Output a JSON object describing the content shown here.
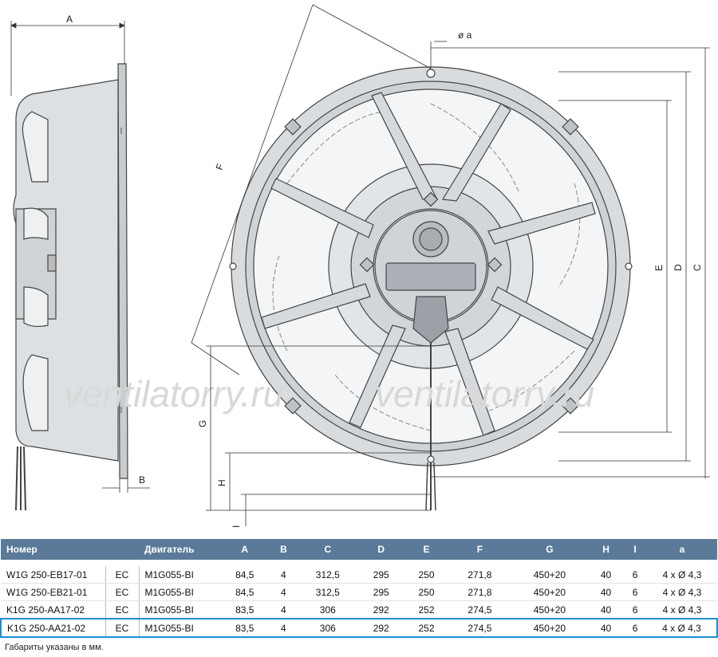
{
  "drawing": {
    "dim_labels": {
      "A": "A",
      "B": "B",
      "C": "C",
      "D": "D",
      "E": "E",
      "F": "F",
      "G": "G",
      "H": "H",
      "I": "I",
      "a": "ø a"
    },
    "watermark": "ventilatorry.ru"
  },
  "table": {
    "headers": [
      "Номер",
      "",
      "Двигатель",
      "A",
      "B",
      "C",
      "D",
      "E",
      "F",
      "G",
      "H",
      "I",
      "a"
    ],
    "rows": [
      {
        "model": "W1G 250-EB17-01",
        "type": "EC",
        "motor": "M1G055-BI",
        "A": "84,5",
        "B": "4",
        "C": "312,5",
        "D": "295",
        "E": "250",
        "F": "271,8",
        "G": "450+20",
        "H": "40",
        "I": "6",
        "a": "4 x Ø 4,3"
      },
      {
        "model": "W1G 250-EB21-01",
        "type": "EC",
        "motor": "M1G055-BI",
        "A": "84,5",
        "B": "4",
        "C": "312,5",
        "D": "295",
        "E": "250",
        "F": "271,8",
        "G": "450+20",
        "H": "40",
        "I": "6",
        "a": "4 x Ø 4,3"
      },
      {
        "model": "K1G 250-AA17-02",
        "type": "EC",
        "motor": "M1G055-BI",
        "A": "83,5",
        "B": "4",
        "C": "306",
        "D": "292",
        "E": "252",
        "F": "274,5",
        "G": "450+20",
        "H": "40",
        "I": "6",
        "a": "4 x Ø 4,3"
      },
      {
        "model": "K1G 250-AA21-02",
        "type": "EC",
        "motor": "M1G055-BI",
        "A": "83,5",
        "B": "4",
        "C": "306",
        "D": "292",
        "E": "252",
        "F": "274,5",
        "G": "450+20",
        "H": "40",
        "I": "6",
        "a": "4 x Ø 4,3"
      }
    ],
    "highlighted_row": 3
  },
  "footnote": "Габариты указаны в мм.",
  "colors": {
    "header_bg": "#5b7a99",
    "highlight": "#1f8fd0",
    "fan_body": "#d9dcde",
    "fan_stroke": "#4a4a4a"
  }
}
